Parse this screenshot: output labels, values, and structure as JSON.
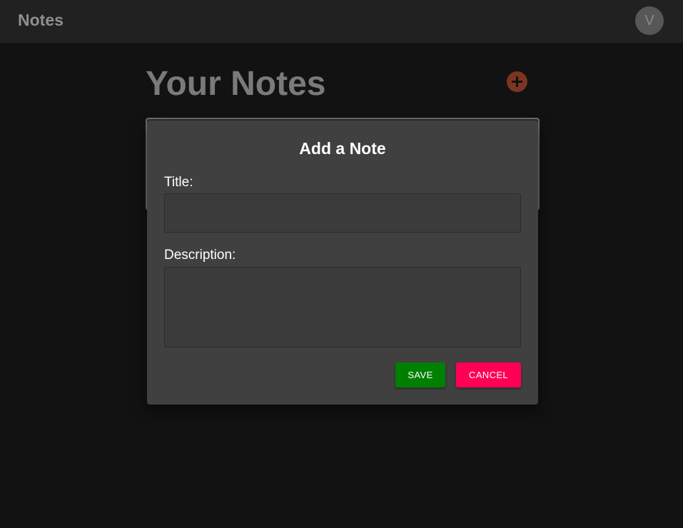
{
  "topbar": {
    "app_title": "Notes",
    "avatar_initial": "V"
  },
  "main": {
    "heading": "Your Notes",
    "add_icon": "plus-circle-icon"
  },
  "dialog": {
    "title": "Add a Note",
    "title_label": "Title:",
    "title_value": "",
    "description_label": "Description:",
    "description_value": "",
    "save_label": "SAVE",
    "cancel_label": "CANCEL"
  },
  "colors": {
    "background": "#121212",
    "topbar": "#212121",
    "dialog": "#404040",
    "save": "#008000",
    "cancel": "#ff0055",
    "accent": "#7c3522"
  }
}
